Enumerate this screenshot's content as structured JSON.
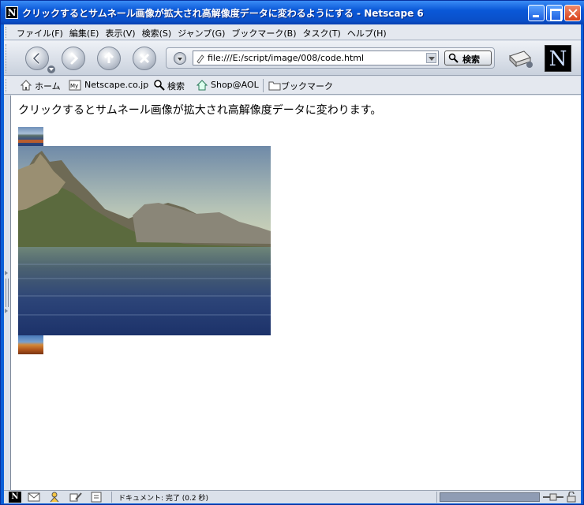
{
  "window": {
    "title": "クリックするとサムネール画像が拡大され高解像度データに変わるようにする - Netscape 6",
    "app_icon_letter": "N"
  },
  "menubar": {
    "items": [
      "ファイル(F)",
      "編集(E)",
      "表示(V)",
      "検索(S)",
      "ジャンプ(G)",
      "ブックマーク(B)",
      "タスク(T)",
      "ヘルプ(H)"
    ]
  },
  "navbar": {
    "url": "file:///E:/script/image/008/code.html",
    "search_label": "検索",
    "logo_letter": "N"
  },
  "personal_toolbar": {
    "home": "ホーム",
    "netscape": "Netscape.co.jp",
    "search": "検索",
    "shop": "Shop@AOL",
    "bookmarks": "ブックマーク"
  },
  "page": {
    "text": "クリックするとサムネール画像が拡大され高解像度データに変わります。"
  },
  "statusbar": {
    "text": "ドキュメント: 完了 (0.2 秒)"
  },
  "colors": {
    "title_bar": "#0a58d8",
    "chrome": "#dbe1ea",
    "close_button": "#d8421c"
  }
}
